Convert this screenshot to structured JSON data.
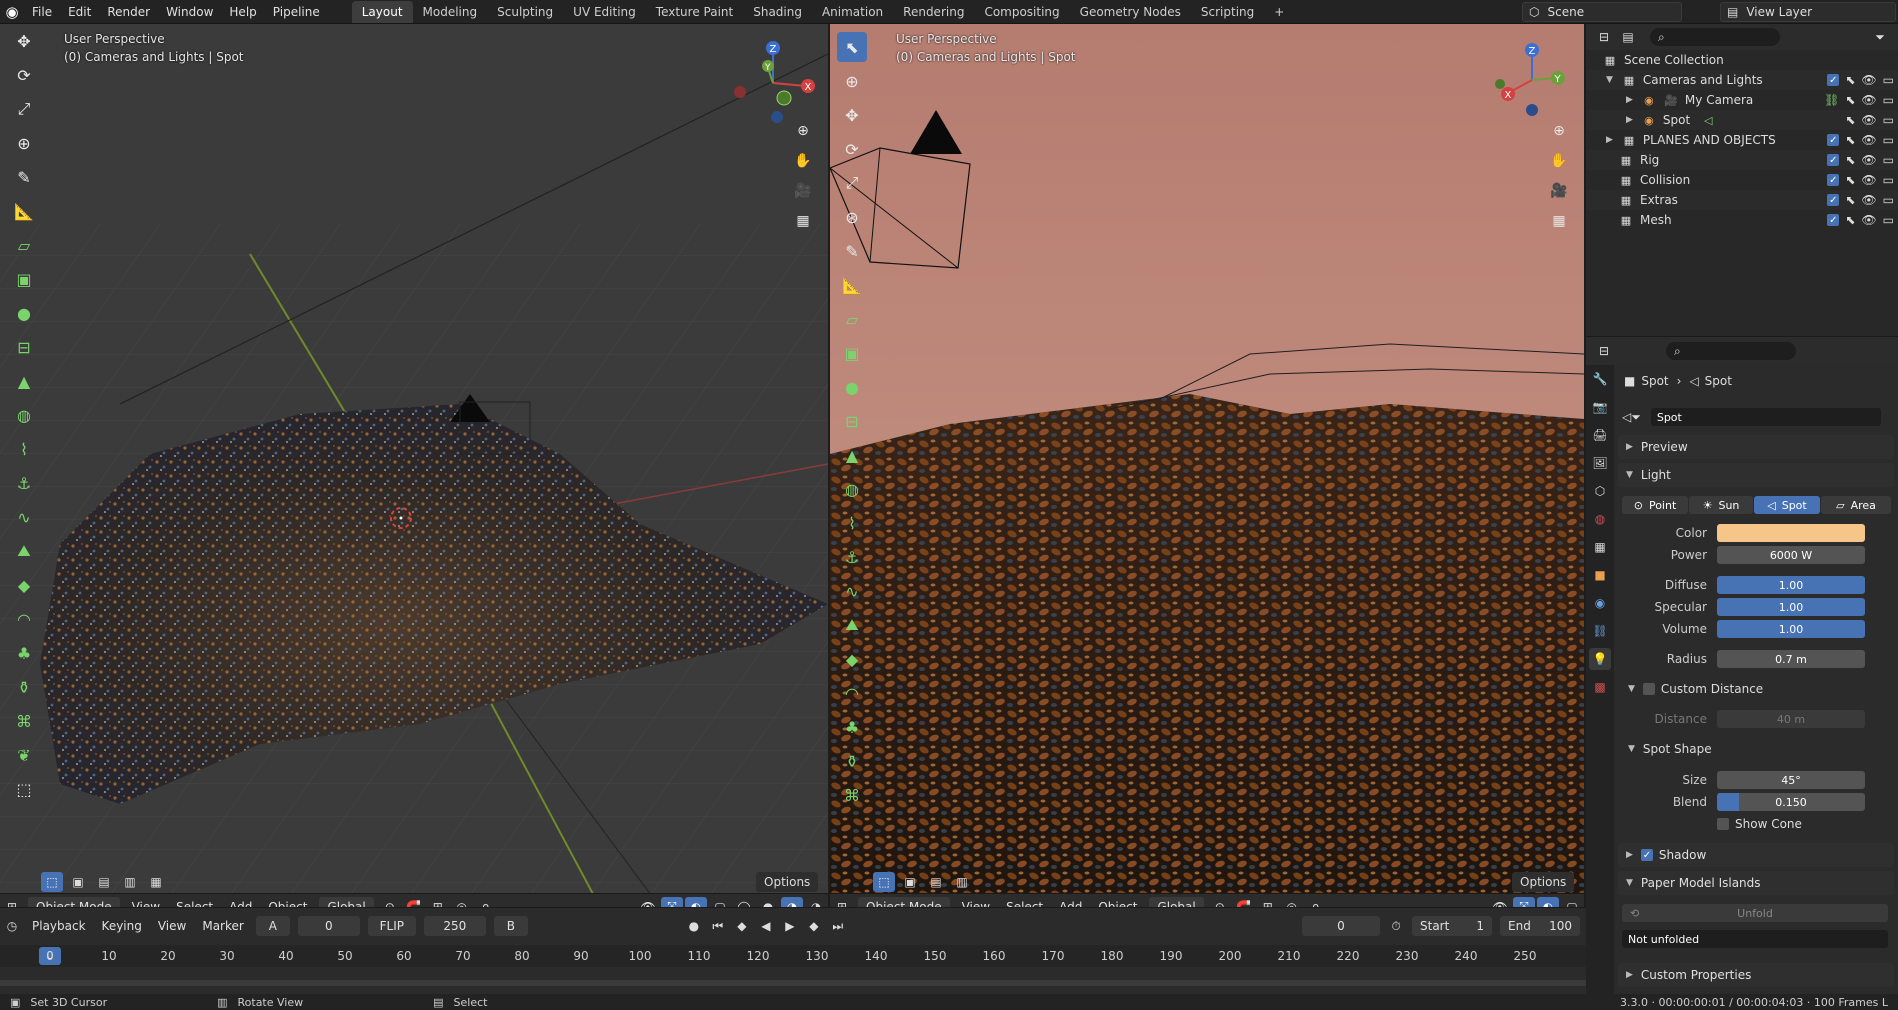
{
  "topbar": {
    "menus": [
      "File",
      "Edit",
      "Render",
      "Window",
      "Help",
      "Pipeline"
    ],
    "workspaces": [
      "Layout",
      "Modeling",
      "Sculpting",
      "UV Editing",
      "Texture Paint",
      "Shading",
      "Animation",
      "Rendering",
      "Compositing",
      "Geometry Nodes",
      "Scripting"
    ],
    "add_tab": "+",
    "scene": "Scene",
    "view_layer": "View Layer"
  },
  "viewport_left": {
    "perspective": "User Perspective",
    "context": "(0) Cameras and Lights | Spot",
    "mode": "Object Mode",
    "menus": [
      "View",
      "Select",
      "Add",
      "Object"
    ],
    "transform": "Global",
    "options": "Options"
  },
  "viewport_right": {
    "perspective": "User Perspective",
    "context": "(0) Cameras and Lights | Spot",
    "mode": "Object Mode",
    "menus": [
      "View",
      "Select",
      "Add",
      "Object"
    ],
    "transform": "Global",
    "options": "Options"
  },
  "outliner": {
    "root": "Scene Collection",
    "items": [
      {
        "label": "Cameras and Lights",
        "level": 1
      },
      {
        "label": "My Camera",
        "level": 2
      },
      {
        "label": "Spot",
        "level": 2
      },
      {
        "label": "PLANES AND OBJECTS",
        "level": 1
      },
      {
        "label": "Rig",
        "level": 1
      },
      {
        "label": "Collision",
        "level": 1
      },
      {
        "label": "Extras",
        "level": 1
      },
      {
        "label": "Mesh",
        "level": 1
      }
    ]
  },
  "properties": {
    "breadcrumb_object": "Spot",
    "breadcrumb_data": "Spot",
    "data_name": "Spot",
    "preview": "Preview",
    "light": "Light",
    "light_types": [
      "Point",
      "Sun",
      "Spot",
      "Area"
    ],
    "active_type": "Spot",
    "color_label": "Color",
    "light_color": "#f5c58a",
    "power_label": "Power",
    "power": "6000 W",
    "diffuse_label": "Diffuse",
    "diffuse": "1.00",
    "specular_label": "Specular",
    "specular": "1.00",
    "volume_label": "Volume",
    "volume": "1.00",
    "radius_label": "Radius",
    "radius": "0.7 m",
    "custom_distance": "Custom Distance",
    "distance_label": "Distance",
    "distance": "40 m",
    "spot_shape": "Spot Shape",
    "size_label": "Size",
    "size": "45°",
    "blend_label": "Blend",
    "blend": "0.150",
    "blend_fraction": 0.15,
    "show_cone": "Show Cone",
    "shadow": "Shadow",
    "paper_model": "Paper Model Islands",
    "unfold": "Unfold",
    "not_unfolded": "Not unfolded",
    "custom_props": "Custom Properties"
  },
  "timeline": {
    "playback": "Playback",
    "keying": "Keying",
    "view": "View",
    "marker": "Marker",
    "a_label": "A",
    "a_value": "0",
    "flip": "FLIP",
    "flip_value": "250",
    "b_label": "B",
    "current_frame": "0",
    "start_label": "Start",
    "start": "1",
    "end_label": "End",
    "end": "100",
    "ticks": [
      0,
      10,
      20,
      30,
      40,
      50,
      60,
      70,
      80,
      90,
      100,
      110,
      120,
      130,
      140,
      150,
      160,
      170,
      180,
      190,
      200,
      210,
      220,
      230,
      240,
      250
    ]
  },
  "statusbar": {
    "left": "Set 3D Cursor",
    "middle": "Rotate View",
    "right": "Select",
    "info": "3.3.0 · 00:00:00:01 / 00:00:04:03 · 100 Frames L"
  }
}
